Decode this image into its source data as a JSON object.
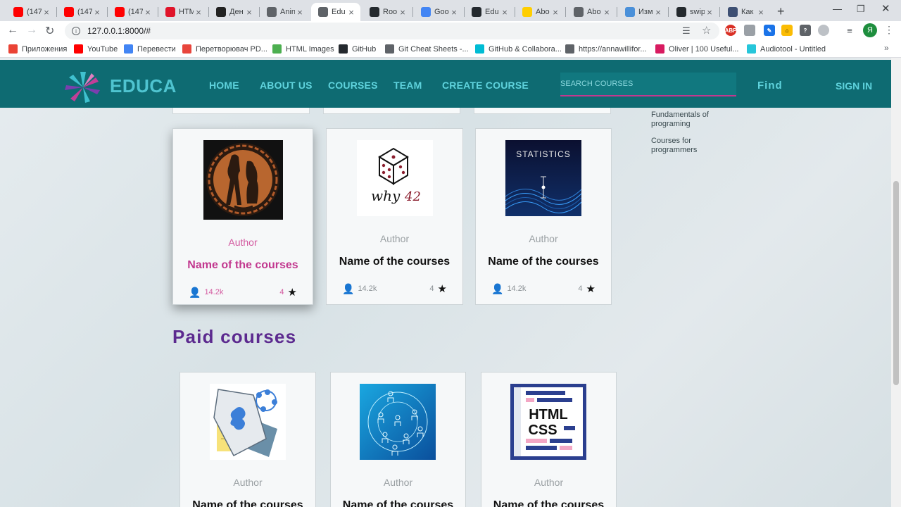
{
  "browser": {
    "tabs": [
      {
        "title": "(147",
        "icon": "youtube-icon",
        "color": "#ff0000"
      },
      {
        "title": "(147",
        "icon": "youtube-icon",
        "color": "#ff0000"
      },
      {
        "title": "(147",
        "icon": "youtube-icon",
        "color": "#ff0000"
      },
      {
        "title": "HTM",
        "icon": "opera-icon",
        "color": "#e0142a"
      },
      {
        "title": "Ден",
        "icon": "site-icon",
        "color": "#222222"
      },
      {
        "title": "Anin",
        "icon": "globe-icon",
        "color": "#5f6368"
      },
      {
        "title": "Edu",
        "icon": "globe-icon",
        "color": "#5f6368"
      },
      {
        "title": "Roo",
        "icon": "github-icon",
        "color": "#24292e"
      },
      {
        "title": "Goo",
        "icon": "translate-icon",
        "color": "#4285f4"
      },
      {
        "title": "Edu",
        "icon": "github-icon",
        "color": "#24292e"
      },
      {
        "title": "Abo",
        "icon": "natgeo-icon",
        "color": "#ffce00"
      },
      {
        "title": "Abo",
        "icon": "globe-icon",
        "color": "#5f6368"
      },
      {
        "title": "Изм",
        "icon": "snow-icon",
        "color": "#4a90d9"
      },
      {
        "title": "swip",
        "icon": "github-icon",
        "color": "#24292e"
      },
      {
        "title": "Как",
        "icon": "bookmark-app-icon",
        "color": "#3d4f73"
      }
    ],
    "url": "127.0.0.1:8000/#",
    "profile_initial": "Я",
    "bookmarks": [
      {
        "label": "Приложения",
        "color": "#ea4335"
      },
      {
        "label": "YouTube",
        "color": "#ff0000"
      },
      {
        "label": "Перевести",
        "color": "#4285f4"
      },
      {
        "label": "Перетворювач PD...",
        "color": "#e8453c"
      },
      {
        "label": "HTML Images",
        "color": "#4caf50"
      },
      {
        "label": "GitHub",
        "color": "#24292e"
      },
      {
        "label": "Git Cheat Sheets -...",
        "color": "#5f6368"
      },
      {
        "label": "GitHub & Collabora...",
        "color": "#00bcd4"
      },
      {
        "label": "https://annawillifor...",
        "color": "#5f6368"
      },
      {
        "label": "Oliver | 100 Useful...",
        "color": "#d81b60"
      },
      {
        "label": "Audiotool - Untitled",
        "color": "#26c6da"
      }
    ]
  },
  "site": {
    "logo": "EDUCA",
    "nav": [
      "HOME",
      "ABOUT US",
      "COURSES",
      "TEAM",
      "CREATE COURSE"
    ],
    "search_placeholder": "SEARCH COURSES",
    "find_label": "Find",
    "signin_label": "SIGN IN",
    "categories": [
      "Fundamentals of programing",
      "Courses for programmers"
    ],
    "free_cards": [
      {
        "author": "Author",
        "name": "Name of the courses",
        "students": "14.2k",
        "rating": "4",
        "image": "greek-vase",
        "hover": true
      },
      {
        "author": "Author",
        "name": "Name of the courses",
        "students": "14.2k",
        "rating": "4",
        "image": "why42-dice",
        "hover": false
      },
      {
        "author": "Author",
        "name": "Name of the courses",
        "students": "14.2k",
        "rating": "4",
        "image": "statistics",
        "hover": false
      }
    ],
    "paid_title": "Paid courses",
    "paid_cards": [
      {
        "author": "Author",
        "name": "Name of the courses",
        "image": "puzzle-doc"
      },
      {
        "author": "Author",
        "name": "Name of the courses",
        "image": "network-people"
      },
      {
        "author": "Author",
        "name": "Name of the courses",
        "image": "html-css"
      }
    ],
    "image_texts": {
      "why": "why",
      "num": "42",
      "stats": "STATISTICS",
      "html": "HTML",
      "css": "CSS"
    }
  },
  "colors": {
    "nav_bg": "#0e6b72",
    "nav_text": "#5fd3dd",
    "accent_pink": "#c2388f",
    "paid_title": "#5c2a8f"
  }
}
